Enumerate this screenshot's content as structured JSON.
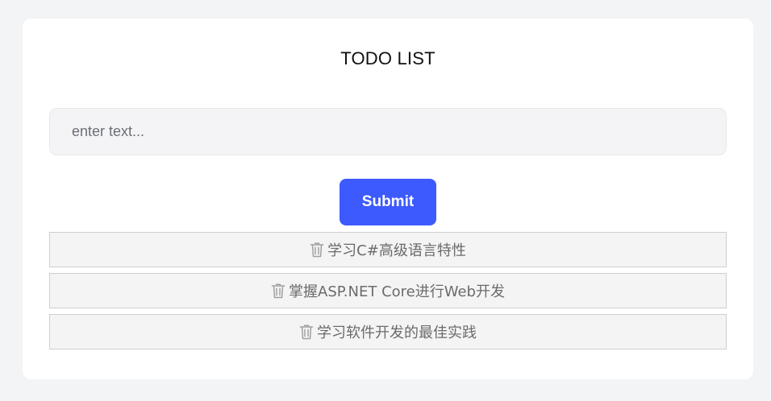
{
  "app": {
    "title": "TODO LIST"
  },
  "form": {
    "input_value": "",
    "input_placeholder": "enter text...",
    "submit_label": "Submit"
  },
  "todos": [
    {
      "text": "学习C#高级语言特性",
      "icon": "trash-icon"
    },
    {
      "text": "掌握ASP.NET Core进行Web开发",
      "icon": "trash-icon"
    },
    {
      "text": "学习软件开发的最佳实践",
      "icon": "trash-icon"
    }
  ],
  "colors": {
    "page_background": "#f3f4f6",
    "card_background": "#ffffff",
    "button_accent": "#3d5afe",
    "item_background": "#f4f4f4",
    "item_border": "#cfcfcf",
    "item_text": "#6b6b6b"
  }
}
